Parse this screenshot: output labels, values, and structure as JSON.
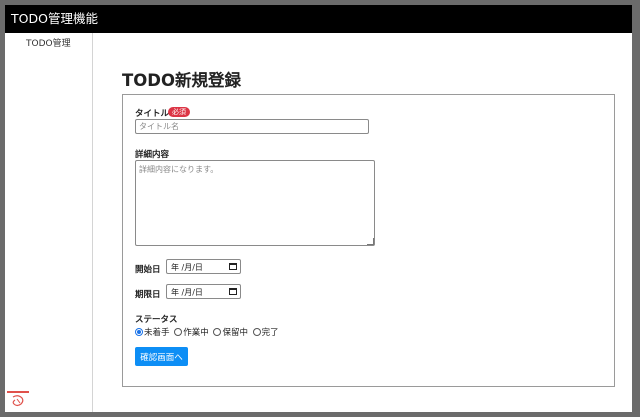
{
  "header": {
    "app_title": "TODO管理機能"
  },
  "sidebar": {
    "link_label": "TODO管理"
  },
  "main": {
    "page_title": "TODO新規登録"
  },
  "form": {
    "title_label": "タイトル",
    "required_badge": "必須",
    "title_placeholder": "タイトル名",
    "detail_label": "詳細内容",
    "detail_placeholder": "詳細内容になります。",
    "start_date_label": "開始日",
    "start_date_value": "年 /月/日",
    "due_date_label": "期限日",
    "due_date_value": "年 /月/日",
    "status_label": "ステータス",
    "status_options": [
      "未着手",
      "作業中",
      "保留中",
      "完了"
    ],
    "status_selected": "未着手",
    "confirm_button": "確認画面へ"
  },
  "colors": {
    "header_bg": "#000000",
    "primary_button": "#0d8ef5",
    "badge": "#dc3545"
  }
}
